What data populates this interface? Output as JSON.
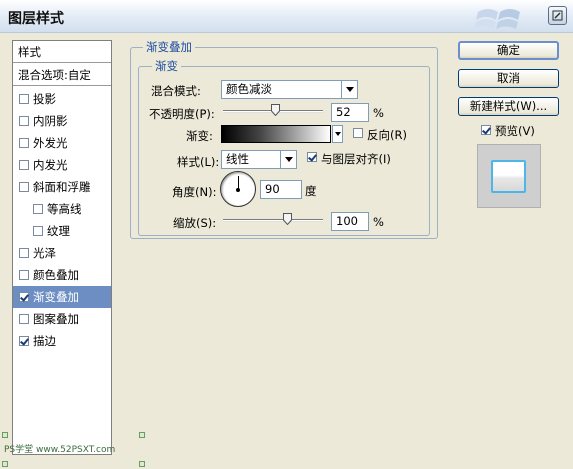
{
  "window": {
    "title": "图层样式",
    "close_icon": "close-icon"
  },
  "left_panel": {
    "header": "样式",
    "blend_options": "混合选项:自定",
    "items": [
      {
        "label": "投影",
        "checked": false,
        "indent": false,
        "selected": false
      },
      {
        "label": "内阴影",
        "checked": false,
        "indent": false,
        "selected": false
      },
      {
        "label": "外发光",
        "checked": false,
        "indent": false,
        "selected": false
      },
      {
        "label": "内发光",
        "checked": false,
        "indent": false,
        "selected": false
      },
      {
        "label": "斜面和浮雕",
        "checked": false,
        "indent": false,
        "selected": false
      },
      {
        "label": "等高线",
        "checked": false,
        "indent": true,
        "selected": false
      },
      {
        "label": "纹理",
        "checked": false,
        "indent": true,
        "selected": false
      },
      {
        "label": "光泽",
        "checked": false,
        "indent": false,
        "selected": false
      },
      {
        "label": "颜色叠加",
        "checked": false,
        "indent": false,
        "selected": false
      },
      {
        "label": "渐变叠加",
        "checked": true,
        "indent": false,
        "selected": true
      },
      {
        "label": "图案叠加",
        "checked": false,
        "indent": false,
        "selected": false
      },
      {
        "label": "描边",
        "checked": true,
        "indent": false,
        "selected": false
      }
    ]
  },
  "gradient_overlay": {
    "section_title": "渐变叠加",
    "subsection_title": "渐变",
    "blend_mode_label": "混合模式:",
    "blend_mode_value": "颜色减淡",
    "opacity_label": "不透明度(P):",
    "opacity_value": "52",
    "opacity_unit": "%",
    "gradient_label": "渐变:",
    "reverse_label": "反向(R)",
    "reverse_checked": false,
    "style_label": "样式(L):",
    "style_value": "线性",
    "align_label": "与图层对齐(I)",
    "align_checked": true,
    "angle_label": "角度(N):",
    "angle_value": "90",
    "angle_unit": "度",
    "angle_degrees": 90,
    "scale_label": "缩放(S):",
    "scale_value": "100",
    "scale_unit": "%",
    "scale_percent": 100
  },
  "buttons": {
    "ok": "确定",
    "cancel": "取消",
    "new_style": "新建样式(W)...",
    "preview_label": "预览(V)",
    "preview_checked": true
  },
  "watermark": "PS学堂 www.52PSXT.com",
  "colors": {
    "accent": "#1f4ea3",
    "selection": "#6c8ec2",
    "preview_border": "#4cb6e8"
  }
}
